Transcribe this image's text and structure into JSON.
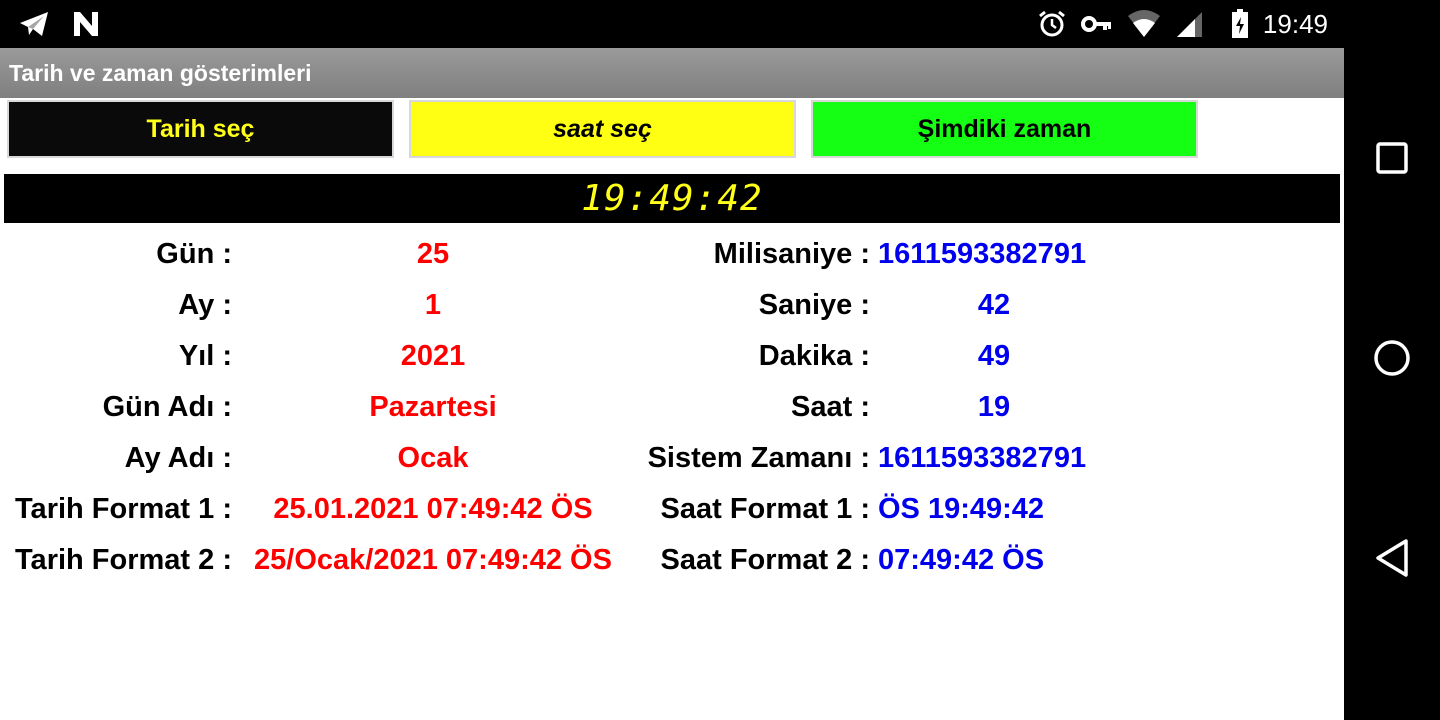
{
  "status_bar": {
    "time": "19:49",
    "left_icons": [
      "telegram-icon",
      "n-notification-icon"
    ],
    "right_icons": [
      "alarm-icon",
      "vpn-key-icon",
      "wifi-icon",
      "signal-icon",
      "battery-charging-icon"
    ]
  },
  "app": {
    "title": "Tarih ve zaman gösterimleri",
    "buttons": {
      "date": "Tarih seç",
      "time": "saat seç",
      "now": "Şimdiki zaman"
    },
    "clock": "19:49:42",
    "rows": [
      {
        "left_label": "Gün :",
        "left_value": "25",
        "right_label": "Milisaniye :",
        "right_value": "1611593382791"
      },
      {
        "left_label": "Ay :",
        "left_value": "1",
        "right_label": "Saniye :",
        "right_value": "42"
      },
      {
        "left_label": "Yıl :",
        "left_value": "2021",
        "right_label": "Dakika :",
        "right_value": "49"
      },
      {
        "left_label": "Gün Adı :",
        "left_value": "Pazartesi",
        "right_label": "Saat :",
        "right_value": "19"
      },
      {
        "left_label": "Ay Adı :",
        "left_value": "Ocak",
        "right_label": "Sistem Zamanı :",
        "right_value": "1611593382791"
      },
      {
        "left_label": "Tarih Format 1 :",
        "left_value": "25.01.2021 07:49:42 ÖS",
        "right_label": "Saat Format 1 :",
        "right_value": "ÖS 19:49:42"
      },
      {
        "left_label": "Tarih Format 2 :",
        "left_value": "25/Ocak/2021 07:49:42 ÖS",
        "right_label": "Saat Format 2 :",
        "right_value": "07:49:42 ÖS"
      }
    ]
  },
  "nav_bar": {
    "icons": [
      "recents-square-icon",
      "home-circle-icon",
      "back-triangle-icon"
    ]
  },
  "colors": {
    "left_value": "#ff0000",
    "right_value": "#0000ee",
    "clock_text": "#ffff1a",
    "button_time_bg": "#ffff14",
    "button_now_bg": "#14ff14"
  }
}
